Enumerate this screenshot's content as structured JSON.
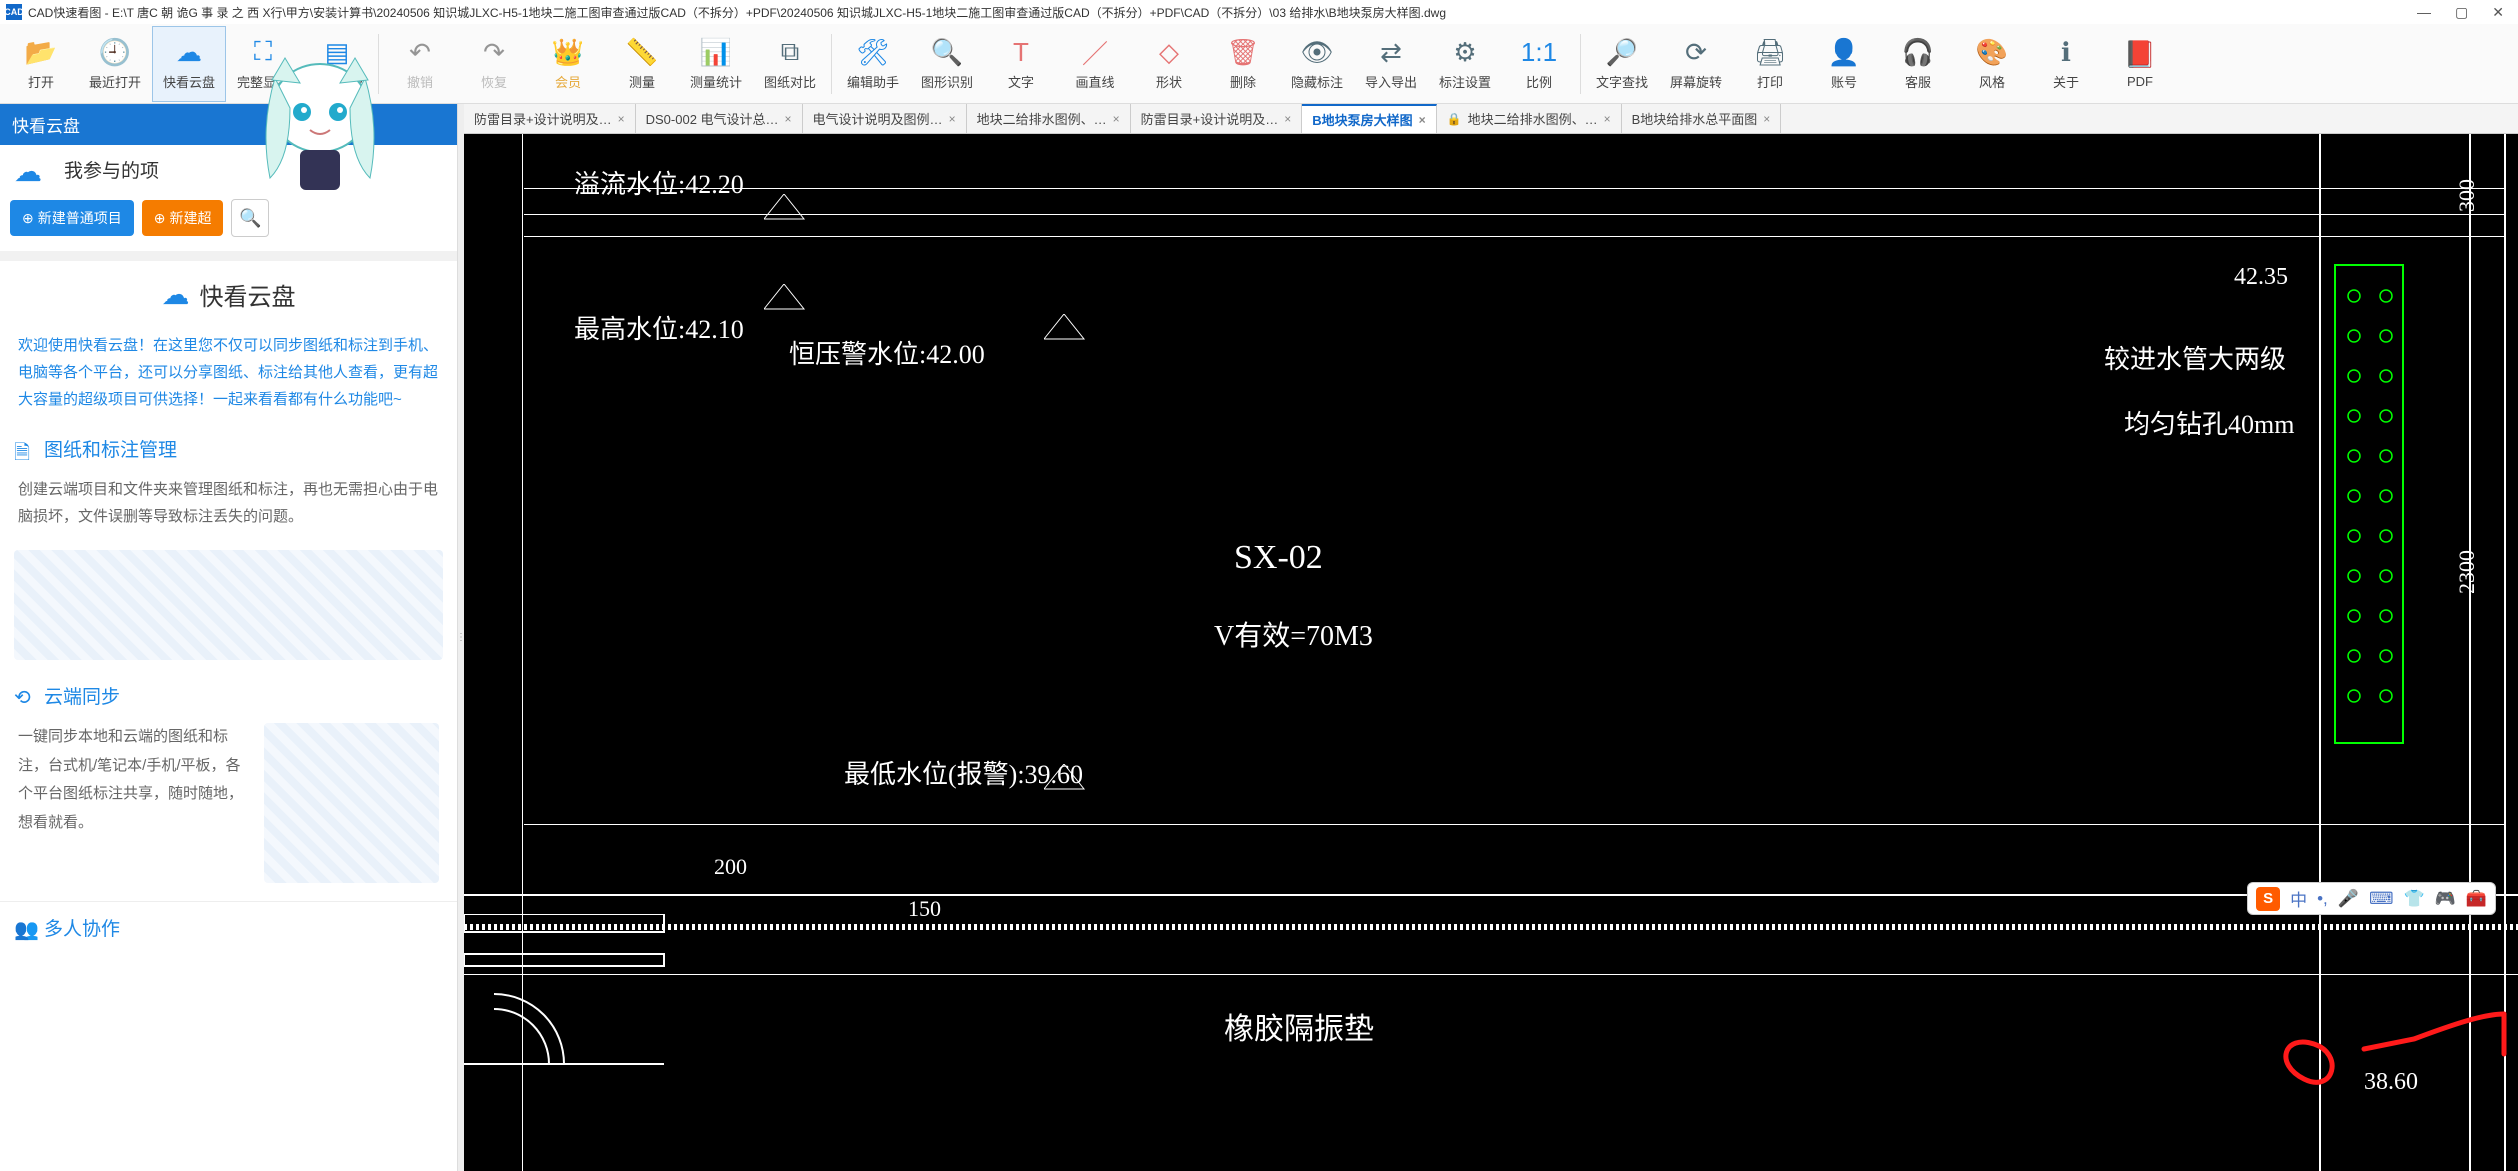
{
  "title": "CAD快速看图 - E:\\T 唐C 朝 诡G 事 录 之 西 X行\\甲方\\安装计算书\\20240506 知识城JLXC-H5-1地块二施工图审查通过版CAD（不拆分）+PDF\\20240506 知识城JLXC-H5-1地块二施工图审查通过版CAD（不拆分）+PDF\\CAD（不拆分）\\03 给排水\\B地块泵房大样图.dwg",
  "toolbar": {
    "open": "打开",
    "recent": "最近打开",
    "cloud": "快看云盘",
    "full": "完整显示",
    "layer": "图层管理",
    "undo": "撤销",
    "redo": "恢复",
    "vip": "会员",
    "measure": "测量",
    "stats": "测量统计",
    "compare": "图纸对比",
    "helper": "编辑助手",
    "recog": "图形识别",
    "text": "文字",
    "line": "画直线",
    "shape": "形状",
    "delete": "删除",
    "hide": "隐藏标注",
    "io": "导入导出",
    "settings": "标注设置",
    "scale": "比例",
    "findtxt": "文字查找",
    "rotate": "屏幕旋转",
    "print": "打印",
    "account": "账号",
    "service": "客服",
    "style": "风格",
    "about": "关于",
    "pdf": "PDF"
  },
  "sidebar": {
    "panel_title": "快看云盘",
    "my_project": "我参与的项",
    "new_normal": "新建普通项目",
    "new_adv": "新建超",
    "brand": "快看云盘",
    "welcome": "欢迎使用快看云盘！在这里您不仅可以同步图纸和标注到手机、电脑等各个平台，还可以分享图纸、标注给其他人查看，更有超大容量的超级项目可供选择！一起来看看都有什么功能吧~",
    "sec1_title": "图纸和标注管理",
    "sec1_body": "创建云端项目和文件夹来管理图纸和标注，再也无需担心由于电脑损坏，文件误删等导致标注丢失的问题。",
    "sec2_title": "云端同步",
    "sec2_body": "一键同步本地和云端的图纸和标注，台式机/笔记本/手机/平板，各个平台图纸标注共享，随时随地，想看就看。",
    "sec3_title": "多人协作"
  },
  "tabs": [
    {
      "label": "防雷目录+设计说明及…",
      "active": false,
      "lock": false
    },
    {
      "label": "DS0-002 电气设计总…",
      "active": false,
      "lock": false
    },
    {
      "label": "电气设计说明及图例…",
      "active": false,
      "lock": false
    },
    {
      "label": "地块二给排水图例、…",
      "active": false,
      "lock": false
    },
    {
      "label": "防雷目录+设计说明及…",
      "active": false,
      "lock": false
    },
    {
      "label": "B地块泵房大样图",
      "active": true,
      "lock": false
    },
    {
      "label": "地块二给排水图例、…",
      "active": false,
      "lock": true
    },
    {
      "label": "B地块给排水总平面图",
      "active": false,
      "lock": false
    }
  ],
  "cad": {
    "l1": "溢流水位:42.20",
    "l2": "最高水位:42.10",
    "l3": "恒压警水位:42.00",
    "l4": "SX-02",
    "l5": "V有效=70M3",
    "l6": "最低水位(报警):39.60",
    "l7": "橡胶隔振垫",
    "l8": "较进水管大两级",
    "l9": "均匀钻孔40mm",
    "d1": "42.35",
    "d2": "38.60",
    "d3": "200",
    "d4": "150",
    "d5": "300",
    "d6": "2300"
  },
  "ime": {
    "mode": "中"
  }
}
